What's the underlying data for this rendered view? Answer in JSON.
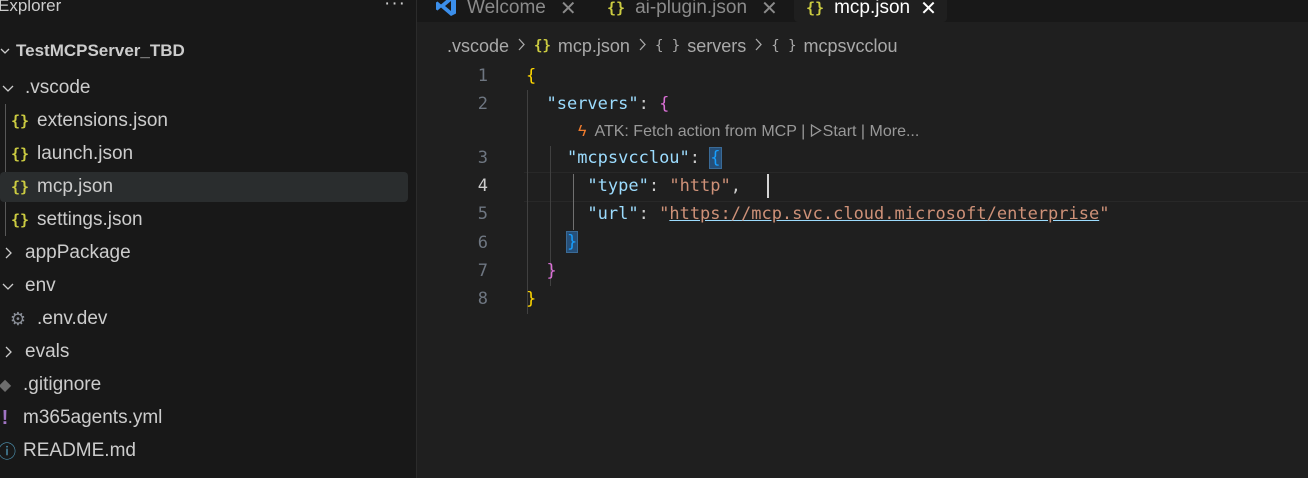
{
  "explorer": {
    "title": "Explorer",
    "more_label": "···",
    "project": "TestMCPServer_TBD",
    "items": [
      {
        "label": ".vscode"
      },
      {
        "label": "extensions.json"
      },
      {
        "label": "launch.json"
      },
      {
        "label": "mcp.json"
      },
      {
        "label": "settings.json"
      },
      {
        "label": "appPackage"
      },
      {
        "label": "env"
      },
      {
        "label": ".env.dev"
      },
      {
        "label": "evals"
      },
      {
        "label": ".gitignore"
      },
      {
        "label": "m365agents.yml"
      },
      {
        "label": "README.md"
      }
    ],
    "selected": "mcp.json"
  },
  "tabs": [
    {
      "label": "Welcome",
      "icon": "vscode-icon"
    },
    {
      "label": "ai-plugin.json",
      "icon": "json-braces-icon"
    },
    {
      "label": "mcp.json",
      "icon": "json-braces-icon",
      "active": true
    }
  ],
  "breadcrumb": [
    {
      "label": ".vscode"
    },
    {
      "label": "mcp.json",
      "icon": "{}"
    },
    {
      "label": "servers",
      "icon": "{ }"
    },
    {
      "label": "mcpsvcclou",
      "icon": "{ }"
    }
  ],
  "editor": {
    "line_numbers": [
      "1",
      "2",
      "3",
      "4",
      "5",
      "6",
      "7",
      "8"
    ],
    "current_line": "4",
    "codelens": {
      "action": "ATK: Fetch action from MCP",
      "sep1": "|",
      "start": "Start",
      "sep2": "|",
      "more": "More..."
    },
    "code": {
      "key_servers": "\"servers\"",
      "key_mcpsvcclou": "\"mcpsvcclou\"",
      "key_type": "\"type\"",
      "val_type": "\"http\"",
      "key_url": "\"url\"",
      "val_url_q": "\"",
      "val_url": "https://mcp.svc.cloud.microsoft/enterprise"
    }
  },
  "colors": {
    "background": "#1f1f1f",
    "sidebar": "#181818",
    "json_icon": "#cbcb41",
    "key": "#9cdcfe",
    "string": "#ce9178",
    "bracket_level1": "#ffd700",
    "bracket_level2": "#da70d6",
    "bracket_level3": "#179fff"
  }
}
